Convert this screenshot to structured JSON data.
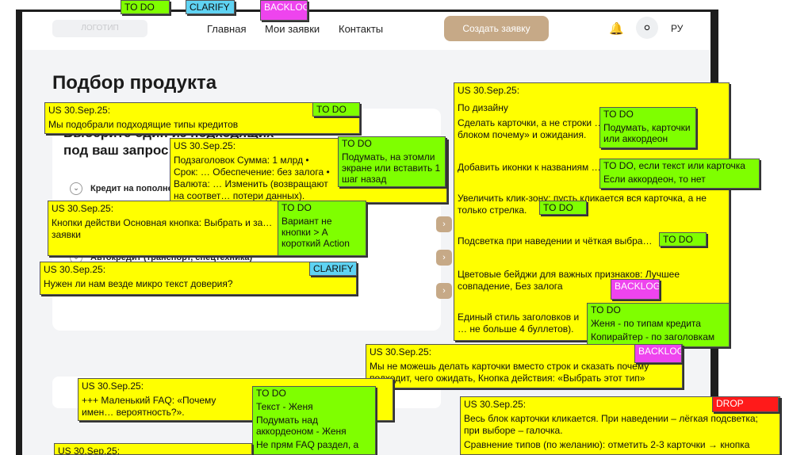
{
  "header": {
    "logo": "ЛОГОТИП",
    "nav": [
      "Главная",
      "Мои заявки",
      "Контакты"
    ],
    "cta": "Создать заявку",
    "lang": "РУ"
  },
  "page": {
    "title": "Подбор продукта",
    "card_heading_line1": "Выберите один из подходящих",
    "card_heading_line2": "под ваш запрос",
    "rows": [
      "Кредит на пополнение",
      "Автокредит (транспорт, спецтехника)"
    ]
  },
  "top_tags": [
    "TO DO",
    "CLARIFY",
    "BACKLOG"
  ],
  "notes": {
    "n1": {
      "us": "US 30.Sep.25:",
      "text": "Мы подобрали подходящие типы кредитов",
      "tag": "TO DO"
    },
    "n2": {
      "us": "US 30.Sep.25:",
      "text": "Подзаголовок Сумма: 1 млрд • Срок: … Обеспечение: без залога • Валюта: … Изменить (возвращают на соответ… потери данных).",
      "tag": "TO DO",
      "tag_text": "Подумать, на этомли экране или вставить 1 шаг назад"
    },
    "n3": {
      "us": "US 30.Sep.25:",
      "text": "Кнопки действи Основная кнопка: Выбрать и за… заявки",
      "tag": "TO DO",
      "tag_text": "Вариант не кнопки > А короткий Action"
    },
    "n4": {
      "us": "US 30.Sep.25:",
      "text": "Нужен ли нам везде микро текст доверия?",
      "tag": "CLARIFY"
    },
    "n5": {
      "us": "US 30.Sep.25:",
      "lines": [
        "По дизайну",
        "Сделать карточки, а не строки … блоком почему» и ожидания.",
        "Добавить иконки к названиям …",
        "Увеличить клик-зону: пусть кликается вся карточка, а не только стрелка.",
        "Подсветка при наведении и чёткая выбра…",
        "Цветовые бейджи для важных признаков: Лучшее совпадение, Без залога",
        "Единый стиль заголовков и … не больше 4 буллетов)."
      ]
    },
    "n5_tags": [
      {
        "label": "TO DO",
        "text": "Подумать, карточки или аккордеон"
      },
      {
        "label": "TO DO, если текст или карточка",
        "text": "Если аккордеон, то нет"
      },
      {
        "label": "TO DO"
      },
      {
        "label": "TO DO"
      },
      {
        "label": "BACKLOG"
      },
      {
        "label": "TO DO",
        "text1": "Женя - по типам кредита",
        "text2": "Копирайтер - по заголовкам"
      }
    ],
    "n6": {
      "us": "US 30.Sep.25:",
      "text": "Мы не можешь делать карточки вместо строк и сказать почему подходит, чего ожидать, Кнопка действия: «Выбрать этот тип»",
      "tag": "BACKLOG"
    },
    "n7": {
      "us": "US 30.Sep.25:",
      "text": "+++ Маленький FAQ: «Почему имен… вероятность?».",
      "tag": "TO DO",
      "tag_lines": [
        "Текст - Женя",
        "Подумать над аккордеоном - Женя",
        "Не прям FAQ раздел, а"
      ]
    },
    "n8": {
      "us": "US 30.Sep.25:",
      "text1": "Весь блок карточки кликается. При наведении – лёгкая подсветка; при выборе – галочка.",
      "text2": "Сравнение типов (по желанию): отметить 2-3 карточки → кнопка",
      "tag": "DROP"
    },
    "n9": {
      "us": "US 30.Sep.25:"
    }
  }
}
